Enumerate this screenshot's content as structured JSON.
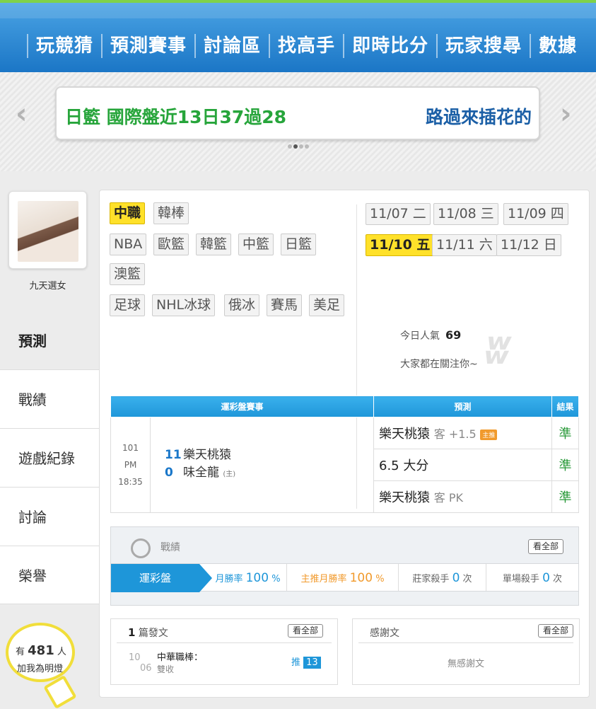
{
  "nav": {
    "items": [
      "玩競猜",
      "預測賽事",
      "討論區",
      "找高手",
      "即時比分",
      "玩家搜尋",
      "數據"
    ]
  },
  "banner": {
    "left_text": "日籃 國際盤近13日37過28",
    "right_text": "路過來插花的",
    "prev": "‹",
    "next": "›"
  },
  "user": {
    "name": "九天選女"
  },
  "menu": [
    {
      "label": "預測",
      "active": true
    },
    {
      "label": "戰績"
    },
    {
      "label": "遊戲紀錄"
    },
    {
      "label": "討論"
    },
    {
      "label": "榮譽"
    }
  ],
  "lamp": {
    "prefix": "有",
    "count": "481",
    "suffix": "人",
    "line2": "加我為明燈"
  },
  "sports": {
    "row1": [
      "中職",
      "韓棒"
    ],
    "row2": [
      "NBA",
      "歐籃",
      "韓籃",
      "中籃",
      "日籃"
    ],
    "row3": [
      "澳籃"
    ],
    "row4": [
      "足球",
      "NHL冰球",
      "俄冰",
      "賽馬",
      "美足"
    ],
    "selected": "中職"
  },
  "dates": {
    "row1": [
      "11/07 二",
      "11/08 三",
      "11/09 四"
    ],
    "row2": [
      "11/10 五",
      "11/11 六",
      "11/12 日"
    ],
    "selected": "11/10 五"
  },
  "popularity": {
    "label": "今日人氣",
    "value": "69",
    "note": "大家都在關注你~"
  },
  "prediction_table": {
    "headers": [
      "運彩盤賽事",
      "預測",
      "結果"
    ],
    "game": {
      "number": "101",
      "time": "PM 18:35",
      "away_score": "11",
      "away_team": "樂天桃猿",
      "home_score": "0",
      "home_team": "味全龍",
      "home_mark": "(主)"
    },
    "rows": [
      {
        "pick": "樂天桃猿",
        "detail": "客 +1.5",
        "badge": "主推",
        "result": "準"
      },
      {
        "pick": "6.5 大分",
        "detail": "",
        "badge": "",
        "result": "準"
      },
      {
        "pick": "樂天桃猿",
        "detail": "客 PK",
        "badge": "",
        "result": "準"
      }
    ]
  },
  "record": {
    "title": "戰績",
    "view_all": "看全部",
    "tab": "運彩盤",
    "monthly_label": "月勝率",
    "monthly_value": "100",
    "monthly_unit": "%",
    "main_label": "主推月勝率",
    "main_value": "100",
    "main_unit": "%",
    "banker_label": "莊家殺手",
    "banker_value": "0",
    "banker_unit": "次",
    "single_label": "單場殺手",
    "single_value": "0",
    "single_unit": "次"
  },
  "posts": {
    "count": "1",
    "title": "篇發文",
    "view_all": "看全部",
    "item": {
      "month": "10",
      "day": "06",
      "title": "中華職棒：",
      "subtitle": "雙收",
      "push_label": "推",
      "push_count": "13"
    }
  },
  "thanks": {
    "title": "感謝文",
    "view_all": "看全部",
    "empty": "無感謝文"
  },
  "colors": {
    "accent": "#1e96d9",
    "highlight": "#ffe12a",
    "green": "#27a53b",
    "orange": "#f19a2c"
  }
}
